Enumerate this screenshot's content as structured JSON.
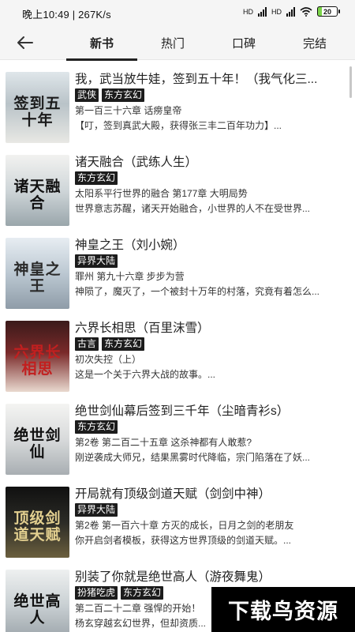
{
  "status_bar": {
    "time_speed": "晚上10:49 | 267K/s",
    "net1": "HD",
    "net2": "HD",
    "battery": "20"
  },
  "nav": {
    "back_icon": "arrow-left-icon",
    "tabs": [
      "新书",
      "热门",
      "口碑",
      "完结"
    ],
    "active_tab": "新书"
  },
  "books": [
    {
      "title": "我，武当放牛娃，签到五十年！（我气化三...",
      "tags": [
        "武侠",
        "东方玄幻"
      ],
      "chapter": "第一百三十六章 话痨皇帝",
      "desc": "【叮，签到真武大殿，获得张三丰二百年功力】...",
      "cover_text": "签到五十年",
      "cover_bg": "linear-gradient(180deg,#dfe6ea 0%,#b9c3c8 45%,#e8e8e4 100%)",
      "cover_fg": "#1b1b1b"
    },
    {
      "title": "诸天融合（武练人生）",
      "tags": [
        "东方玄幻"
      ],
      "chapter": "太阳系平行世界的融合 第177章 大明局势",
      "desc": "世界意志苏醒，诸天开始融合，小世界的人不在受世界...",
      "cover_text": "诸天融合",
      "cover_bg": "linear-gradient(180deg,#f2f2f0 0%,#cfd6d9 50%,#9aa6ab 100%)",
      "cover_fg": "#111111"
    },
    {
      "title": "神皇之王（刘小婉）",
      "tags": [
        "异界大陆"
      ],
      "chapter": "罪州 第九十六章 步步为营",
      "desc": "神陨了，魔灭了，一个被封十万年的村落，究竟有着怎么...",
      "cover_text": "神皇之王",
      "cover_bg": "linear-gradient(180deg,#e7edf2 0%,#bcc8d2 50%,#8f9ca8 100%)",
      "cover_fg": "#2a2a2a"
    },
    {
      "title": "六界长相思（百里沫雪）",
      "tags": [
        "古言",
        "东方玄幻"
      ],
      "chapter": "初次失控（上）",
      "desc": "这是一个关于六界大战的故事。...",
      "cover_text": "六界长相思",
      "cover_bg": "linear-gradient(180deg,#3a1a1a 0%,#7a2a2a 45%,#e9d9cf 100%)",
      "cover_fg": "#c21f1f"
    },
    {
      "title": "绝世剑仙幕后签到三千年（尘暗青衫s）",
      "tags": [
        "东方玄幻"
      ],
      "chapter": "第2卷 第二百二十五章 这杀神都有人敢惹?",
      "desc": "刚逆袭成大师兄，结果黑雾时代降临，宗门陷落在了妖...",
      "cover_text": "绝世剑仙",
      "cover_bg": "linear-gradient(180deg,#f4f4f2 0%,#d8dadb 50%,#a8aeb2 100%)",
      "cover_fg": "#111111"
    },
    {
      "title": "开局就有顶级剑道天赋（剑剑中神）",
      "tags": [
        "异界大陆"
      ],
      "chapter": "第2卷 第一百六十章 方灭的成长，日月之剑的老朋友",
      "desc": "你开启剑者模板，获得这方世界顶级的剑道天赋。...",
      "cover_text": "顶级剑道天赋",
      "cover_bg": "linear-gradient(180deg,#101010 0%,#2b2b26 50%,#6b5f3e 100%)",
      "cover_fg": "#e2cf8f"
    },
    {
      "title": "别装了你就是绝世高人（游夜舞鬼）",
      "tags": [
        "扮猪吃虎",
        "东方玄幻"
      ],
      "chapter": "第二百二十二章 强悍的开始！",
      "desc": "杨玄穿越玄幻世界，但却资质...",
      "cover_text": "绝世高人",
      "cover_bg": "linear-gradient(180deg,#eef0f0 0%,#c9d0d3 50%,#9aa3a8 100%)",
      "cover_fg": "#111111"
    }
  ],
  "watermark": "下载鸟资源"
}
